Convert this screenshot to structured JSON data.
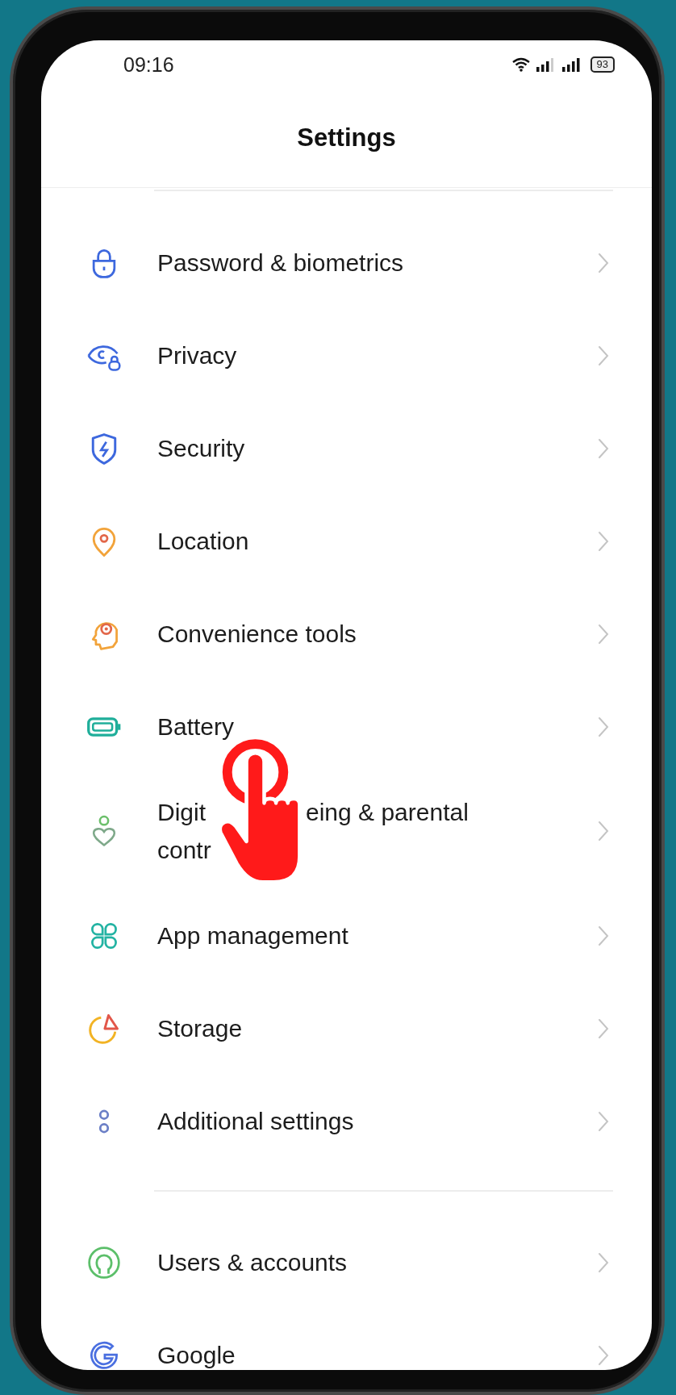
{
  "status_bar": {
    "time": "09:16",
    "battery_text": "93"
  },
  "header": {
    "title": "Settings"
  },
  "groups": [
    {
      "items": [
        {
          "kind": "lock",
          "label": "Password & biometrics"
        },
        {
          "kind": "eye",
          "label": "Privacy"
        },
        {
          "kind": "shield",
          "label": "Security"
        },
        {
          "kind": "pin",
          "label": "Location"
        },
        {
          "kind": "head",
          "label": "Convenience tools"
        },
        {
          "kind": "battery",
          "label": "Battery"
        },
        {
          "kind": "wellbeing",
          "label_fragments": [
            "Digit",
            "eing & parental",
            "contr"
          ]
        },
        {
          "kind": "apps",
          "label": "App management"
        },
        {
          "kind": "storage",
          "label": "Storage"
        },
        {
          "kind": "dots",
          "label": "Additional settings"
        }
      ]
    },
    {
      "items": [
        {
          "kind": "user",
          "label": "Users & accounts"
        },
        {
          "kind": "google",
          "label": "Google"
        }
      ]
    }
  ]
}
